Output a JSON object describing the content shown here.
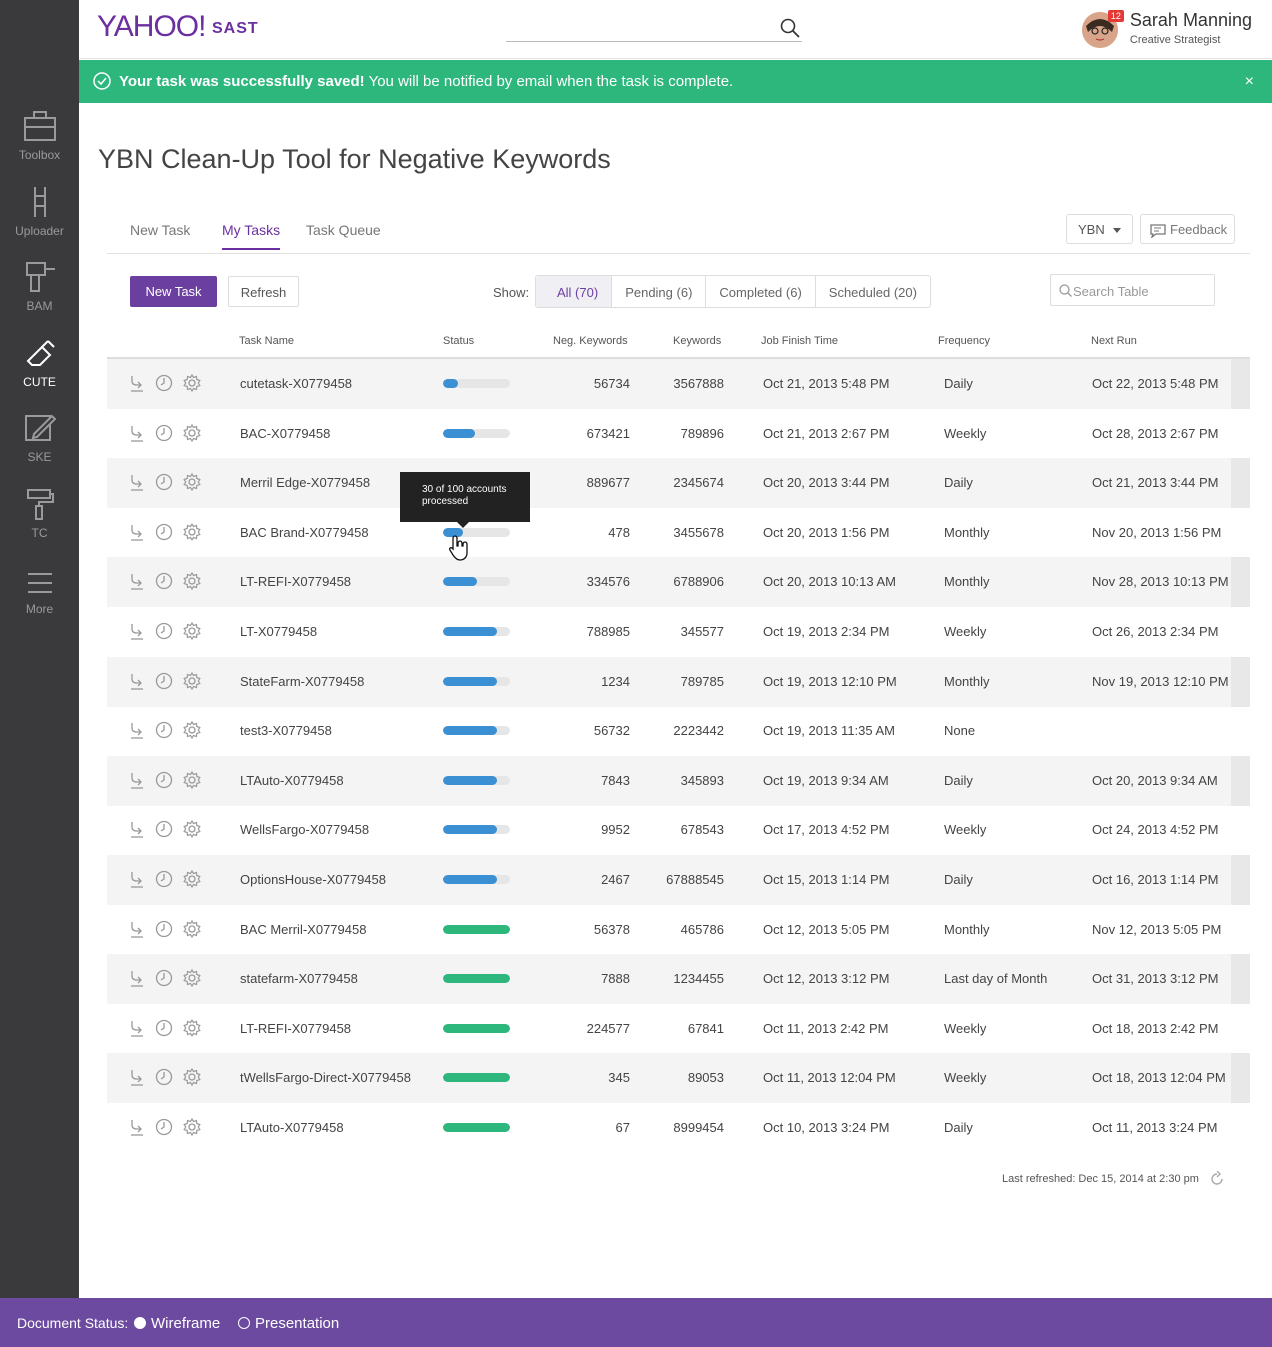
{
  "sidebar": {
    "items": [
      {
        "label": "Toolbox",
        "icon": "toolbox-icon",
        "active": false
      },
      {
        "label": "Uploader",
        "icon": "ladder-icon",
        "active": false
      },
      {
        "label": "BAM",
        "icon": "drill-icon",
        "active": false
      },
      {
        "label": "CUTE",
        "icon": "eraser-icon",
        "active": true
      },
      {
        "label": "SKE",
        "icon": "pencil-icon",
        "active": false
      },
      {
        "label": "TC",
        "icon": "roller-icon",
        "active": false
      },
      {
        "label": "More",
        "icon": "menu-icon",
        "active": false
      }
    ]
  },
  "header": {
    "logo": "YAHOO!",
    "app_name": "SAST",
    "user": {
      "name": "Sarah Manning",
      "role": "Creative Strategist",
      "badge": "12"
    }
  },
  "banner": {
    "title": "Your task was successfully saved!",
    "message": " You will be notified by email when the task is complete.",
    "close": "×"
  },
  "page": {
    "title": "YBN Clean-Up Tool for Negative Keywords"
  },
  "tabs": [
    {
      "label": "New Task",
      "active": false
    },
    {
      "label": "My Tasks",
      "active": true
    },
    {
      "label": "Task Queue",
      "active": false
    }
  ],
  "controls": {
    "ybn_select": "YBN",
    "feedback": "Feedback",
    "new_task": "New Task",
    "refresh": "Refresh",
    "show_label": "Show:",
    "filters": [
      "All (70)",
      "Pending (6)",
      "Completed (6)",
      "Scheduled (20)"
    ],
    "search_placeholder": "Search Table"
  },
  "table": {
    "columns": [
      "Task Name",
      "Status",
      "Neg. Keywords",
      "Keywords",
      "Job Finish Time",
      "Frequency",
      "Next Run"
    ],
    "rows": [
      {
        "name": "cutetask-X0779458",
        "progress": 0.22,
        "state": "running",
        "neg": "56734",
        "kw": "3567888",
        "finish": "Oct 21, 2013 5:48 PM",
        "freq": "Daily",
        "next": "Oct 22, 2013 5:48 PM"
      },
      {
        "name": "BAC-X0779458",
        "progress": 0.48,
        "state": "running",
        "neg": "673421",
        "kw": "789896",
        "finish": "Oct 21, 2013 2:67 PM",
        "freq": "Weekly",
        "next": "Oct 28, 2013 2:67 PM"
      },
      {
        "name": "Merril Edge-X0779458",
        "progress": 0.48,
        "state": "running",
        "neg": "889677",
        "kw": "2345674",
        "finish": "Oct 20, 2013 3:44 PM",
        "freq": "Daily",
        "next": "Oct 21, 2013 3:44 PM"
      },
      {
        "name": "BAC Brand-X0779458",
        "progress": 0.3,
        "state": "running",
        "neg": "478",
        "kw": "3455678",
        "finish": "Oct 20, 2013 1:56 PM",
        "freq": "Monthly",
        "next": "Nov 20, 2013 1:56 PM"
      },
      {
        "name": "LT-REFI-X0779458",
        "progress": 0.5,
        "state": "running",
        "neg": "334576",
        "kw": "6788906",
        "finish": "Oct 20, 2013 10:13 AM",
        "freq": "Monthly",
        "next": "Nov 28, 2013 10:13 PM"
      },
      {
        "name": "LT-X0779458",
        "progress": 0.8,
        "state": "running",
        "neg": "788985",
        "kw": "345577",
        "finish": "Oct 19, 2013 2:34 PM",
        "freq": "Weekly",
        "next": "Oct 26, 2013 2:34 PM"
      },
      {
        "name": "StateFarm-X0779458",
        "progress": 0.8,
        "state": "running",
        "neg": "1234",
        "kw": "789785",
        "finish": "Oct 19, 2013 12:10 PM",
        "freq": "Monthly",
        "next": "Nov 19, 2013 12:10 PM"
      },
      {
        "name": "test3-X0779458",
        "progress": 0.8,
        "state": "running",
        "neg": "56732",
        "kw": "2223442",
        "finish": "Oct 19, 2013 11:35 AM",
        "freq": "None",
        "next": ""
      },
      {
        "name": "LTAuto-X0779458",
        "progress": 0.8,
        "state": "running",
        "neg": "7843",
        "kw": "345893",
        "finish": "Oct 19, 2013 9:34 AM",
        "freq": "Daily",
        "next": "Oct 20, 2013 9:34 AM"
      },
      {
        "name": "WellsFargo-X0779458",
        "progress": 0.8,
        "state": "running",
        "neg": "9952",
        "kw": "678543",
        "finish": "Oct 17, 2013 4:52 PM",
        "freq": "Weekly",
        "next": "Oct 24, 2013 4:52 PM"
      },
      {
        "name": "OptionsHouse-X0779458",
        "progress": 0.8,
        "state": "running",
        "neg": "2467",
        "kw": "67888545",
        "finish": "Oct 15, 2013 1:14 PM",
        "freq": "Daily",
        "next": "Oct 16, 2013 1:14 PM"
      },
      {
        "name": "BAC Merril-X0779458",
        "progress": 1.0,
        "state": "done",
        "neg": "56378",
        "kw": "465786",
        "finish": "Oct 12, 2013 5:05 PM",
        "freq": "Monthly",
        "next": "Nov 12, 2013 5:05 PM"
      },
      {
        "name": "statefarm-X0779458",
        "progress": 1.0,
        "state": "done",
        "neg": "7888",
        "kw": "1234455",
        "finish": "Oct 12, 2013 3:12 PM",
        "freq": "Last day of Month",
        "next": "Oct 31, 2013 3:12 PM"
      },
      {
        "name": "LT-REFI-X0779458",
        "progress": 1.0,
        "state": "done",
        "neg": "224577",
        "kw": "67841",
        "finish": "Oct 11, 2013 2:42 PM",
        "freq": "Weekly",
        "next": "Oct 18, 2013 2:42 PM"
      },
      {
        "name": "tWellsFargo-Direct-X0779458",
        "progress": 1.0,
        "state": "done",
        "neg": "345",
        "kw": "89053",
        "finish": "Oct 11, 2013 12:04 PM",
        "freq": "Weekly",
        "next": "Oct 18, 2013 12:04 PM"
      },
      {
        "name": "LTAuto-X0779458",
        "progress": 1.0,
        "state": "done",
        "neg": "67",
        "kw": "8999454",
        "finish": "Oct 10, 2013 3:24 PM",
        "freq": "Daily",
        "next": "Oct 11, 2013 3:24 PM"
      }
    ]
  },
  "tooltip": {
    "text": "30 of 100 accounts processed"
  },
  "last_refreshed": "Last refreshed: Dec 15, 2014 at 2:30 pm",
  "footer": {
    "label": "Document Status:",
    "options": [
      {
        "label": "Wireframe",
        "selected": true
      },
      {
        "label": "Presentation",
        "selected": false
      }
    ]
  },
  "colors": {
    "brand": "#6b2fa0",
    "running": "#3b8fd3",
    "done": "#2db77d",
    "banner": "#2db77d",
    "footer": "#6b4aa0",
    "sidebar": "#3a3a3c"
  }
}
